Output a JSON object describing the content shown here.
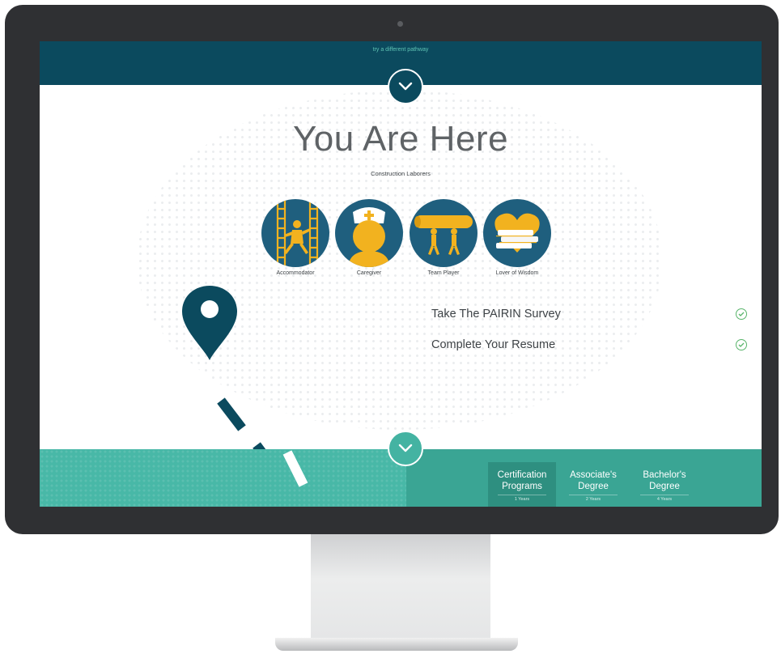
{
  "topbar": {
    "link": "try a different pathway"
  },
  "hero": {
    "title": "You Are Here",
    "occupation": "Construction Laborers"
  },
  "traits": [
    {
      "label": "Accommodator",
      "icon": "ladder-climber-icon"
    },
    {
      "label": "Caregiver",
      "icon": "nurse-icon"
    },
    {
      "label": "Team Player",
      "icon": "team-carry-icon"
    },
    {
      "label": "Lover of Wisdom",
      "icon": "heart-books-icon"
    }
  ],
  "tasks": [
    {
      "label": "Take The PAIRIN Survey",
      "done": true
    },
    {
      "label": "Complete Your Resume",
      "done": true
    }
  ],
  "programs": [
    {
      "name_line1": "Certification",
      "name_line2": "Programs",
      "years": "1 Years",
      "active": true
    },
    {
      "name_line1": "Associate's",
      "name_line2": "Degree",
      "years": "2 Years",
      "active": false
    },
    {
      "name_line1": "Bachelor's",
      "name_line2": "Degree",
      "years": "4 Years",
      "active": false
    }
  ],
  "colors": {
    "navy": "#0b4a5e",
    "teal": "#48b8a7",
    "trait_disc": "#1f5f7e",
    "gold": "#f2b21f",
    "check": "#58b46a"
  }
}
